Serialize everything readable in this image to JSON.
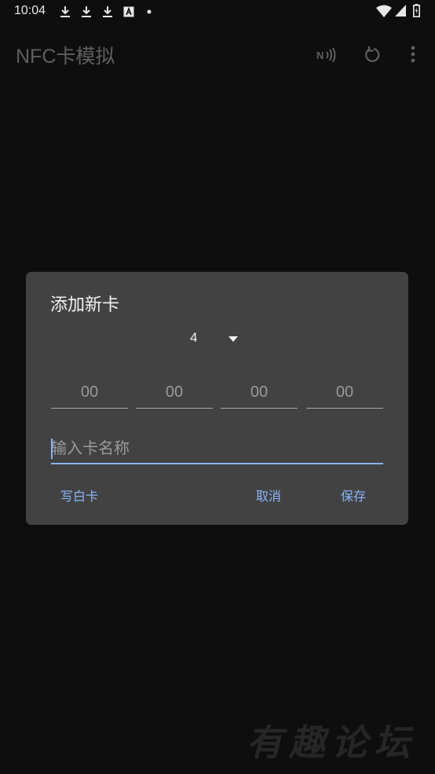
{
  "status_bar": {
    "time": "10:04",
    "icons": [
      "download-icon",
      "download-icon",
      "download-icon",
      "app-notification-icon",
      "dot-icon",
      "wifi-icon",
      "cell-signal-icon",
      "battery-icon"
    ]
  },
  "app_bar": {
    "title": "NFC卡模拟",
    "actions": [
      "nfc-icon",
      "refresh-icon",
      "more-vert-icon"
    ]
  },
  "dialog": {
    "title": "添加新卡",
    "spinner_value": "4",
    "bytes": [
      {
        "placeholder": "00"
      },
      {
        "placeholder": "00"
      },
      {
        "placeholder": "00"
      },
      {
        "placeholder": "00"
      }
    ],
    "name_placeholder": "输入卡名称",
    "buttons": {
      "write_blank": "写白卡",
      "cancel": "取消",
      "save": "保存"
    }
  },
  "watermark": "有趣论坛",
  "colors": {
    "background": "#0e0e0e",
    "dialog": "#424242",
    "accent": "#8ab4f8"
  }
}
